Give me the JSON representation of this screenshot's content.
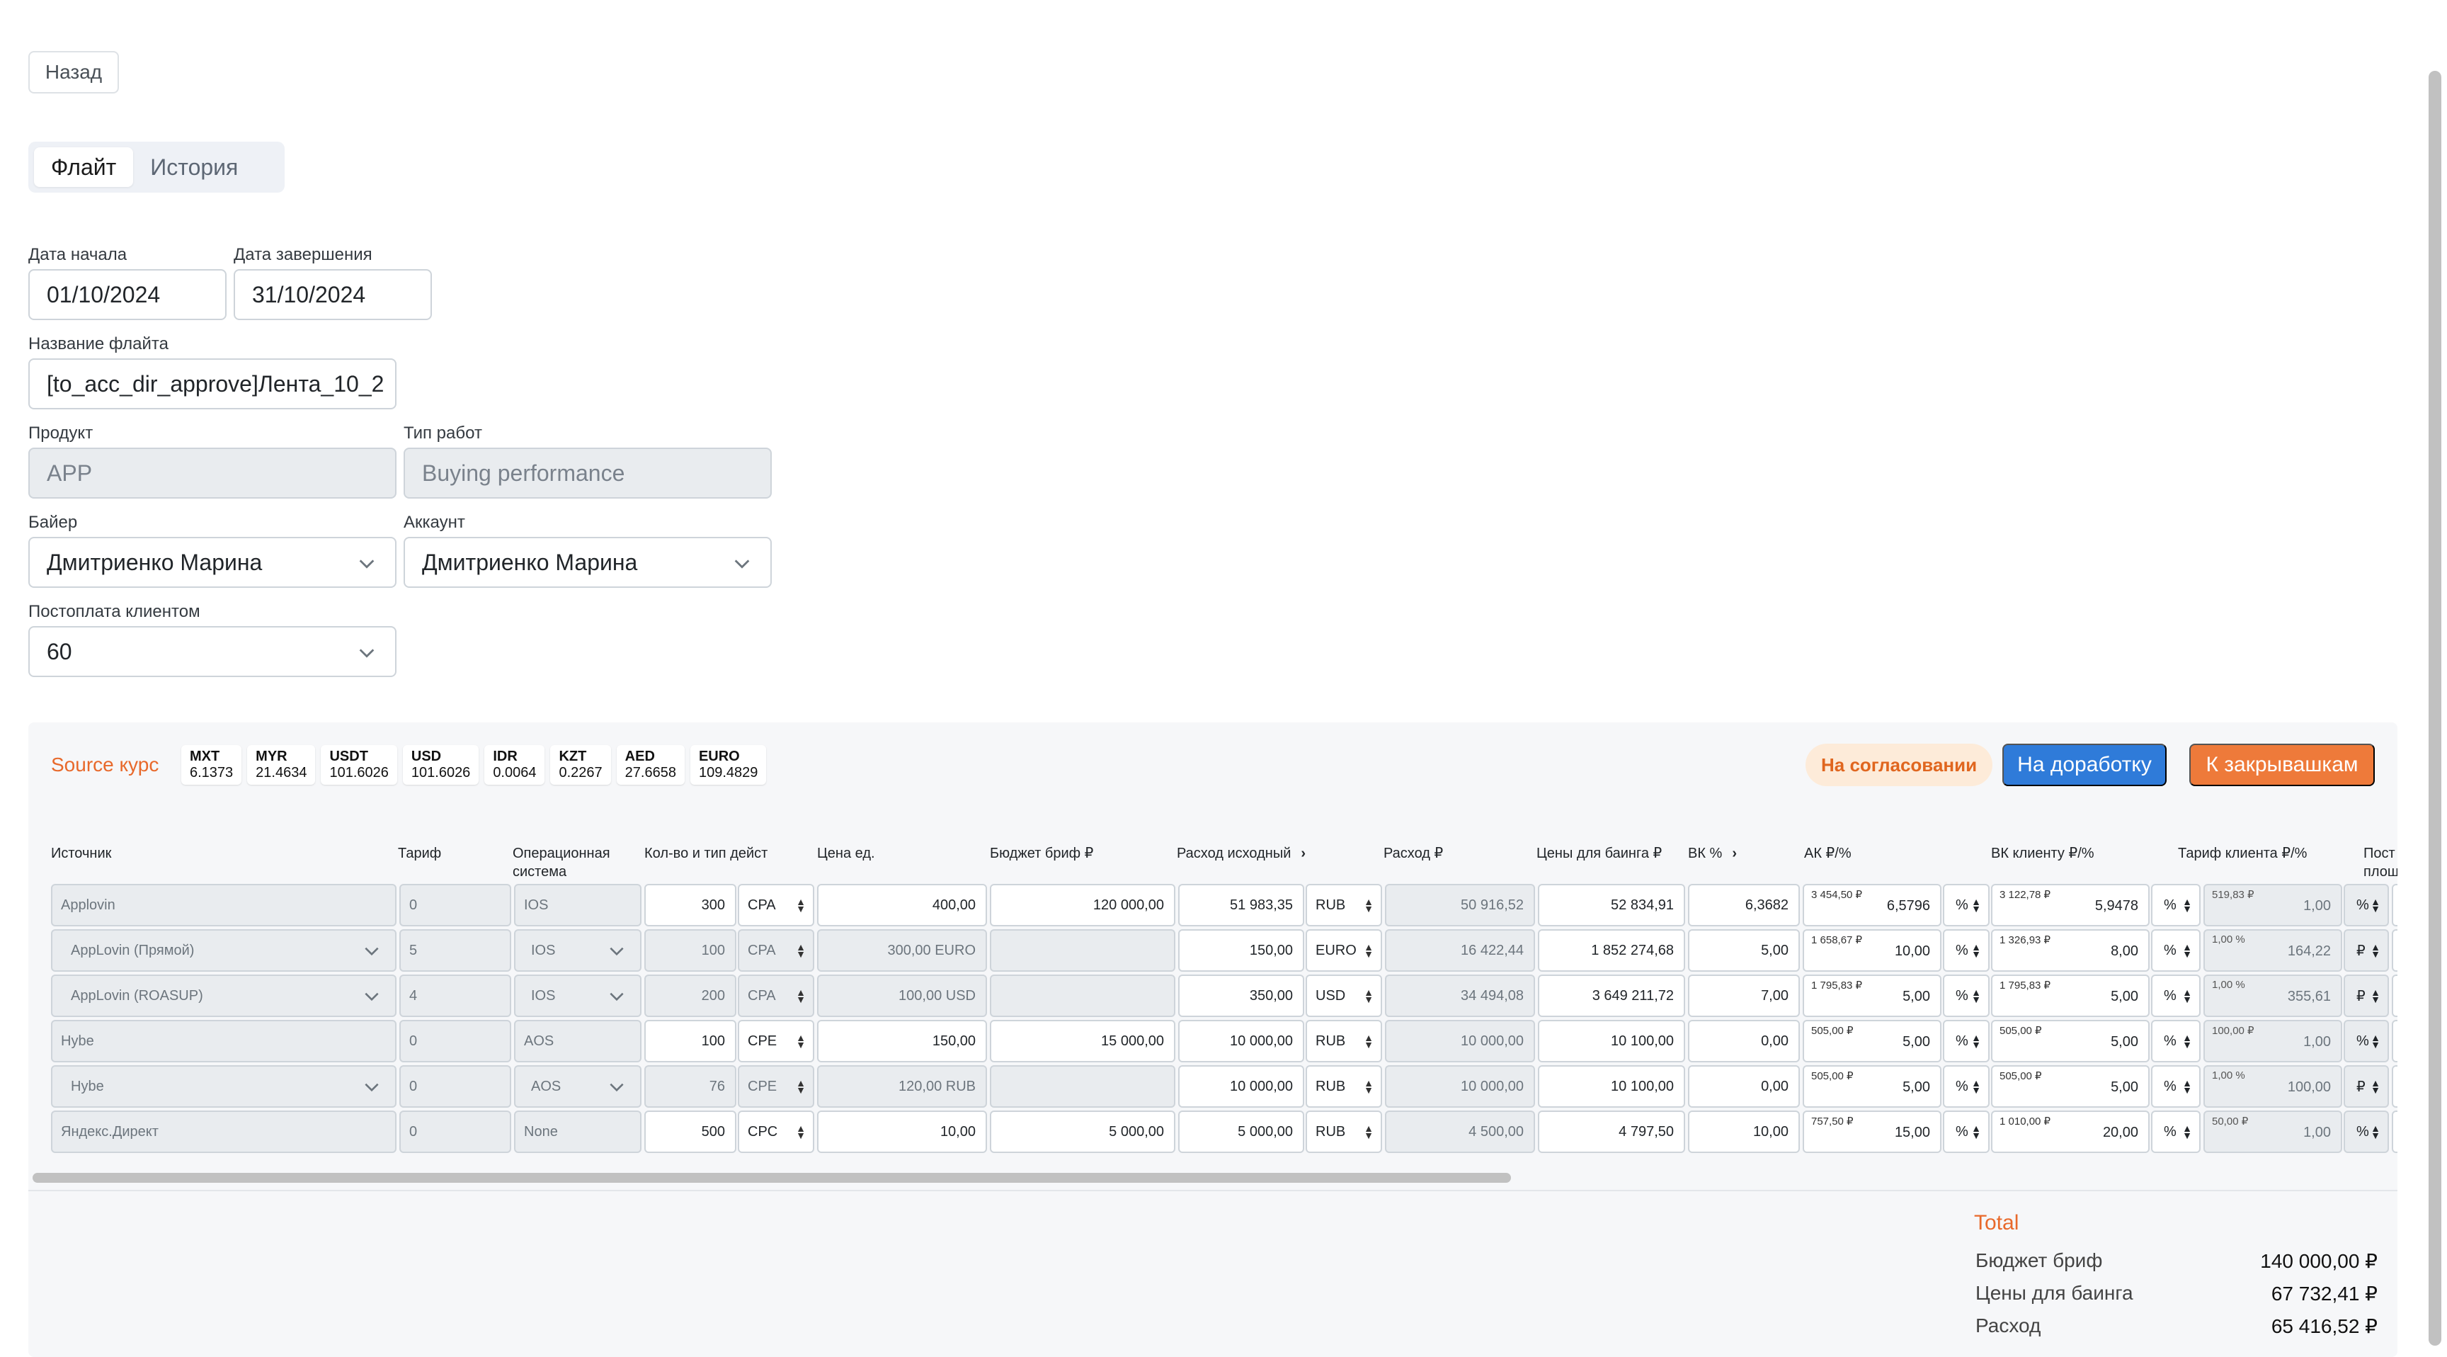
{
  "back_label": "Назад",
  "tabs": [
    {
      "label": "Флайт",
      "active": true
    },
    {
      "label": "История",
      "active": false
    }
  ],
  "form": {
    "start_date_label": "Дата начала",
    "start_date": "01/10/2024",
    "end_date_label": "Дата завершения",
    "end_date": "31/10/2024",
    "flight_name_label": "Название флайта",
    "flight_name": "[to_acc_dir_approve]Лента_10_2",
    "product_label": "Продукт",
    "product": "APP",
    "work_type_label": "Тип работ",
    "work_type": "Buying performance",
    "buyer_label": "Байер",
    "buyer": "Дмитриенко Марина",
    "account_label": "Аккаунт",
    "account": "Дмитриенко Марина",
    "postpay_label": "Постоплата клиентом",
    "postpay": "60"
  },
  "panel": {
    "source_rate_label": "Source курс",
    "rates": [
      {
        "code": "MXT",
        "value": "6.1373"
      },
      {
        "code": "MYR",
        "value": "21.4634"
      },
      {
        "code": "USDT",
        "value": "101.6026"
      },
      {
        "code": "USD",
        "value": "101.6026"
      },
      {
        "code": "IDR",
        "value": "0.0064"
      },
      {
        "code": "KZT",
        "value": "0.2267"
      },
      {
        "code": "AED",
        "value": "27.6658"
      },
      {
        "code": "EURO",
        "value": "109.4829"
      }
    ],
    "status": "На согласовании",
    "rework_label": "На доработку",
    "close_label": "К закрывашкам",
    "status_color": "#e0661f",
    "accent_blue": "#2f7bd9",
    "accent_orange": "#ee7a3a"
  },
  "columns": {
    "source": "Источник",
    "tariff": "Тариф",
    "os_1": "Операционная",
    "os_2": "система",
    "qty": "Кол-во и тип дейст",
    "unit_price": "Цена ед.",
    "budget": "Бюджет бриф ₽",
    "spend_orig": "Расход исходный",
    "spend": "Расход ₽",
    "buying_prices": "Цены для баинга ₽",
    "vk": "ВК %",
    "ak": "АК ₽/%",
    "vk_client": "ВК клиенту ₽/%",
    "client_tariff": "Тариф клиента ₽/%",
    "post_1": "Пост",
    "post_2": "площ"
  },
  "rows": [
    {
      "source": "Applovin",
      "source_select": false,
      "tariff": "0",
      "os": "IOS",
      "os_select": false,
      "qty": "300",
      "qty_ro": false,
      "type": "CPA",
      "price": "400,00",
      "price_ro": false,
      "budget": "120 000,00",
      "budget_ro": false,
      "spend_orig": "51 983,35",
      "currency": "RUB",
      "spend": "50 916,52",
      "buying": "52 834,91",
      "vk": "6,3682",
      "ak_small": "3 454,50 ₽",
      "ak": "6,5796",
      "ak_unit": "%",
      "vkc_small": "3 122,78 ₽",
      "vkc": "5,9478",
      "vkc_unit": "%",
      "ct_small": "519,83 ₽",
      "ct": "1,00",
      "ct_unit": "%"
    },
    {
      "source": "AppLovin (Прямой)",
      "source_select": true,
      "tariff": "5",
      "os": "IOS",
      "os_select": true,
      "qty": "100",
      "qty_ro": true,
      "type": "CPA",
      "price": "300,00 EURO",
      "price_ro": true,
      "budget": "",
      "budget_ro": true,
      "spend_orig": "150,00",
      "currency": "EURO",
      "spend": "16 422,44",
      "buying": "1 852 274,68",
      "vk": "5,00",
      "ak_small": "1 658,67 ₽",
      "ak": "10,00",
      "ak_unit": "%",
      "vkc_small": "1 326,93 ₽",
      "vkc": "8,00",
      "vkc_unit": "%",
      "ct_small": "1,00 %",
      "ct": "164,22",
      "ct_unit": "₽"
    },
    {
      "source": "AppLovin (ROASUP)",
      "source_select": true,
      "tariff": "4",
      "os": "IOS",
      "os_select": true,
      "qty": "200",
      "qty_ro": true,
      "type": "CPA",
      "price": "100,00 USD",
      "price_ro": true,
      "budget": "",
      "budget_ro": true,
      "spend_orig": "350,00",
      "currency": "USD",
      "spend": "34 494,08",
      "buying": "3 649 211,72",
      "vk": "7,00",
      "ak_small": "1 795,83 ₽",
      "ak": "5,00",
      "ak_unit": "%",
      "vkc_small": "1 795,83 ₽",
      "vkc": "5,00",
      "vkc_unit": "%",
      "ct_small": "1,00 %",
      "ct": "355,61",
      "ct_unit": "₽"
    },
    {
      "source": "Hybe",
      "source_select": false,
      "tariff": "0",
      "os": "AOS",
      "os_select": false,
      "qty": "100",
      "qty_ro": false,
      "type": "CPE",
      "price": "150,00",
      "price_ro": false,
      "budget": "15 000,00",
      "budget_ro": false,
      "spend_orig": "10 000,00",
      "currency": "RUB",
      "spend": "10 000,00",
      "buying": "10 100,00",
      "vk": "0,00",
      "ak_small": "505,00 ₽",
      "ak": "5,00",
      "ak_unit": "%",
      "vkc_small": "505,00 ₽",
      "vkc": "5,00",
      "vkc_unit": "%",
      "ct_small": "100,00 ₽",
      "ct": "1,00",
      "ct_unit": "%"
    },
    {
      "source": "Hybe",
      "source_select": true,
      "tariff": "0",
      "os": "AOS",
      "os_select": true,
      "qty": "76",
      "qty_ro": true,
      "type": "CPE",
      "price": "120,00 RUB",
      "price_ro": true,
      "budget": "",
      "budget_ro": true,
      "spend_orig": "10 000,00",
      "currency": "RUB",
      "spend": "10 000,00",
      "buying": "10 100,00",
      "vk": "0,00",
      "ak_small": "505,00 ₽",
      "ak": "5,00",
      "ak_unit": "%",
      "vkc_small": "505,00 ₽",
      "vkc": "5,00",
      "vkc_unit": "%",
      "ct_small": "1,00 %",
      "ct": "100,00",
      "ct_unit": "₽"
    },
    {
      "source": "Яндекс.Директ",
      "source_select": false,
      "tariff": "0",
      "os": "None",
      "os_select": false,
      "qty": "500",
      "qty_ro": false,
      "type": "CPC",
      "price": "10,00",
      "price_ro": false,
      "budget": "5 000,00",
      "budget_ro": false,
      "spend_orig": "5 000,00",
      "currency": "RUB",
      "spend": "4 500,00",
      "buying": "4 797,50",
      "vk": "10,00",
      "ak_small": "757,50 ₽",
      "ak": "15,00",
      "ak_unit": "%",
      "vkc_small": "1 010,00 ₽",
      "vkc": "20,00",
      "vkc_unit": "%",
      "ct_small": "50,00 ₽",
      "ct": "1,00",
      "ct_unit": "%"
    }
  ],
  "total": {
    "title": "Total",
    "items": [
      {
        "label": "Бюджет бриф",
        "value": "140 000,00 ₽"
      },
      {
        "label": "Цены для баинга",
        "value": "67 732,41 ₽"
      },
      {
        "label": "Расход",
        "value": "65 416,52 ₽"
      }
    ]
  }
}
